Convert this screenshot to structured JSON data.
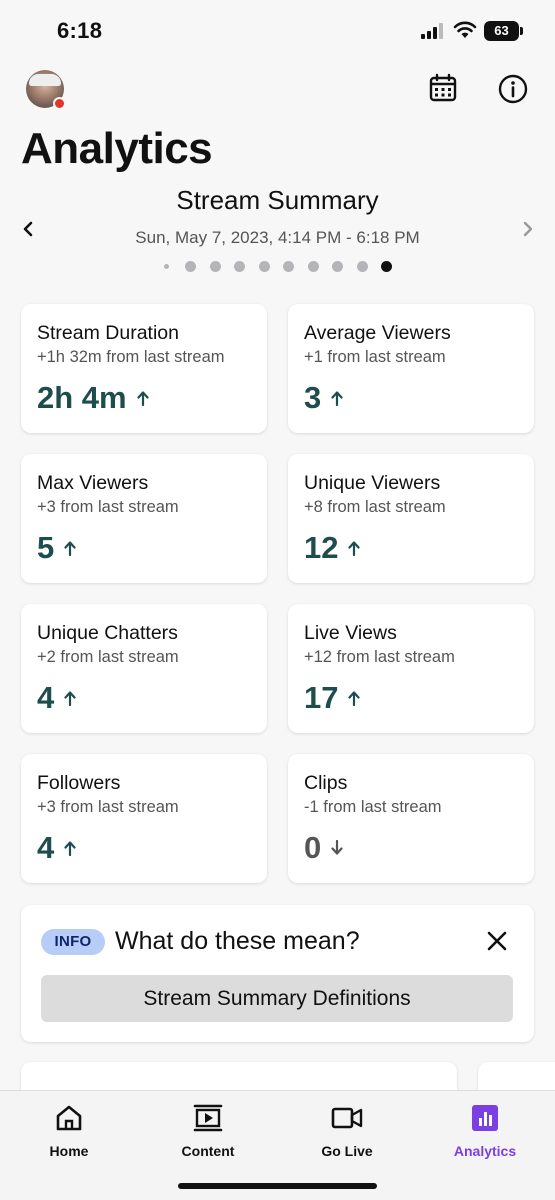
{
  "status_bar": {
    "time": "6:18",
    "battery": "63"
  },
  "header": {
    "title": "Analytics"
  },
  "summary": {
    "title": "Stream Summary",
    "date": "Sun, May 7, 2023, 4:14 PM - 6:18 PM",
    "page_count": 10,
    "active_page": 10
  },
  "stats": [
    {
      "label": "Stream Duration",
      "delta": "+1h 32m from last stream",
      "value": "2h 4m",
      "trend": "up"
    },
    {
      "label": "Average Viewers",
      "delta": "+1 from last stream",
      "value": "3",
      "trend": "up"
    },
    {
      "label": "Max Viewers",
      "delta": "+3 from last stream",
      "value": "5",
      "trend": "up"
    },
    {
      "label": "Unique Viewers",
      "delta": "+8 from last stream",
      "value": "12",
      "trend": "up"
    },
    {
      "label": "Unique Chatters",
      "delta": "+2 from last stream",
      "value": "4",
      "trend": "up"
    },
    {
      "label": "Live Views",
      "delta": "+12 from last stream",
      "value": "17",
      "trend": "up"
    },
    {
      "label": "Followers",
      "delta": "+3 from last stream",
      "value": "4",
      "trend": "up"
    },
    {
      "label": "Clips",
      "delta": "-1 from last stream",
      "value": "0",
      "trend": "down"
    }
  ],
  "info_panel": {
    "badge": "INFO",
    "question": "What do these mean?",
    "button_label": "Stream Summary Definitions"
  },
  "tabs": [
    {
      "label": "Home",
      "icon": "home-icon"
    },
    {
      "label": "Content",
      "icon": "film-icon"
    },
    {
      "label": "Go Live",
      "icon": "video-camera-icon"
    },
    {
      "label": "Analytics",
      "icon": "bar-chart-icon",
      "active": true
    }
  ],
  "colors": {
    "accent": "#7b3fe4",
    "stat_value": "#1e4d4d",
    "live_dot": "#e5332a",
    "info_badge": "#b7cdf7"
  }
}
